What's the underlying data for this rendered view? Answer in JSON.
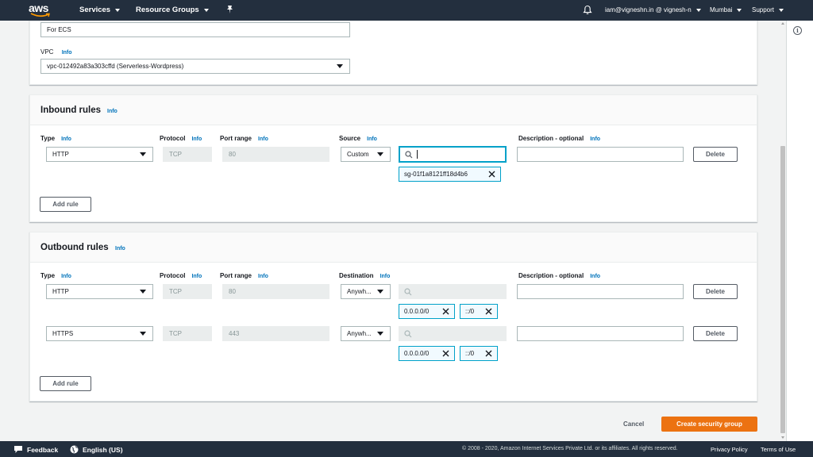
{
  "topnav": {
    "logo_text": "aws",
    "services_label": "Services",
    "resource_groups_label": "Resource Groups",
    "account_label": "iam@vigneshn.in @ vignesh-n",
    "region_label": "Mumbai",
    "support_label": "Support"
  },
  "basic": {
    "description_value": "For ECS",
    "vpc_label": "VPC",
    "vpc_info": "Info",
    "vpc_value": "vpc-012492a83a303cffd (Serverless-Wordpress)"
  },
  "inbound": {
    "title": "Inbound rules",
    "info": "Info",
    "columns": {
      "type": "Type",
      "protocol": "Protocol",
      "port_range": "Port range",
      "source": "Source",
      "description": "Description - optional",
      "info": "Info"
    },
    "rules": [
      {
        "type": "HTTP",
        "protocol": "TCP",
        "port_range": "80",
        "source_type": "Custom",
        "search_value": "",
        "tokens": [
          "sg-01f1a8121ff18d4b6"
        ],
        "description": "",
        "delete_label": "Delete"
      }
    ],
    "add_rule_label": "Add rule"
  },
  "outbound": {
    "title": "Outbound rules",
    "info": "Info",
    "columns": {
      "type": "Type",
      "protocol": "Protocol",
      "port_range": "Port range",
      "destination": "Destination",
      "description": "Description - optional",
      "info": "Info"
    },
    "rules": [
      {
        "type": "HTTP",
        "protocol": "TCP",
        "port_range": "80",
        "destination_type": "Anywh...",
        "tokens": [
          "0.0.0.0/0",
          "::/0"
        ],
        "description": "",
        "delete_label": "Delete"
      },
      {
        "type": "HTTPS",
        "protocol": "TCP",
        "port_range": "443",
        "destination_type": "Anywh...",
        "tokens": [
          "0.0.0.0/0",
          "::/0"
        ],
        "description": "",
        "delete_label": "Delete"
      }
    ],
    "add_rule_label": "Add rule"
  },
  "actions": {
    "cancel_label": "Cancel",
    "create_label": "Create security group"
  },
  "footer": {
    "feedback_label": "Feedback",
    "language_label": "English (US)",
    "copyright": "© 2008 - 2020, Amazon Internet Services Private Ltd. or its affiliates. All rights reserved.",
    "privacy_label": "Privacy Policy",
    "terms_label": "Terms of Use"
  },
  "colors": {
    "nav_bg": "#232f3e",
    "link": "#0073bb",
    "primary": "#ec7211",
    "token_border": "#00a1c9"
  }
}
